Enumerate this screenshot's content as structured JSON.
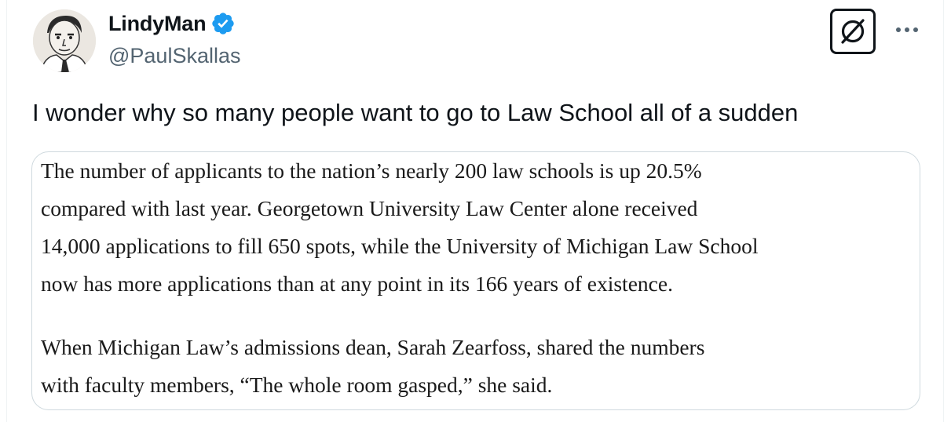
{
  "author": {
    "display_name": "LindyMan",
    "handle": "@PaulSkallas",
    "verified": true,
    "verified_color": "#1d9bf0",
    "avatar_icon": "sketch-portrait-avatar"
  },
  "actions": {
    "grok_icon": "grok-icon",
    "more_icon": "more-options-icon"
  },
  "tweet": {
    "text": "I wonder why so many people want to go to Law School all of a sudden"
  },
  "quote_image": {
    "paragraph_1": [
      "The number of applicants to the nation’s nearly 200 law schools is up 20.5%",
      "compared with last year. Georgetown University Law Center alone received",
      "14,000 applications to fill 650 spots, while the University of Michigan Law School",
      "now has more applications than at any point in its 166 years of existence."
    ],
    "paragraph_2": [
      "When Michigan Law’s admissions dean, Sarah Zearfoss, shared the numbers",
      "with faculty members, “The whole room gasped,” she said."
    ]
  }
}
